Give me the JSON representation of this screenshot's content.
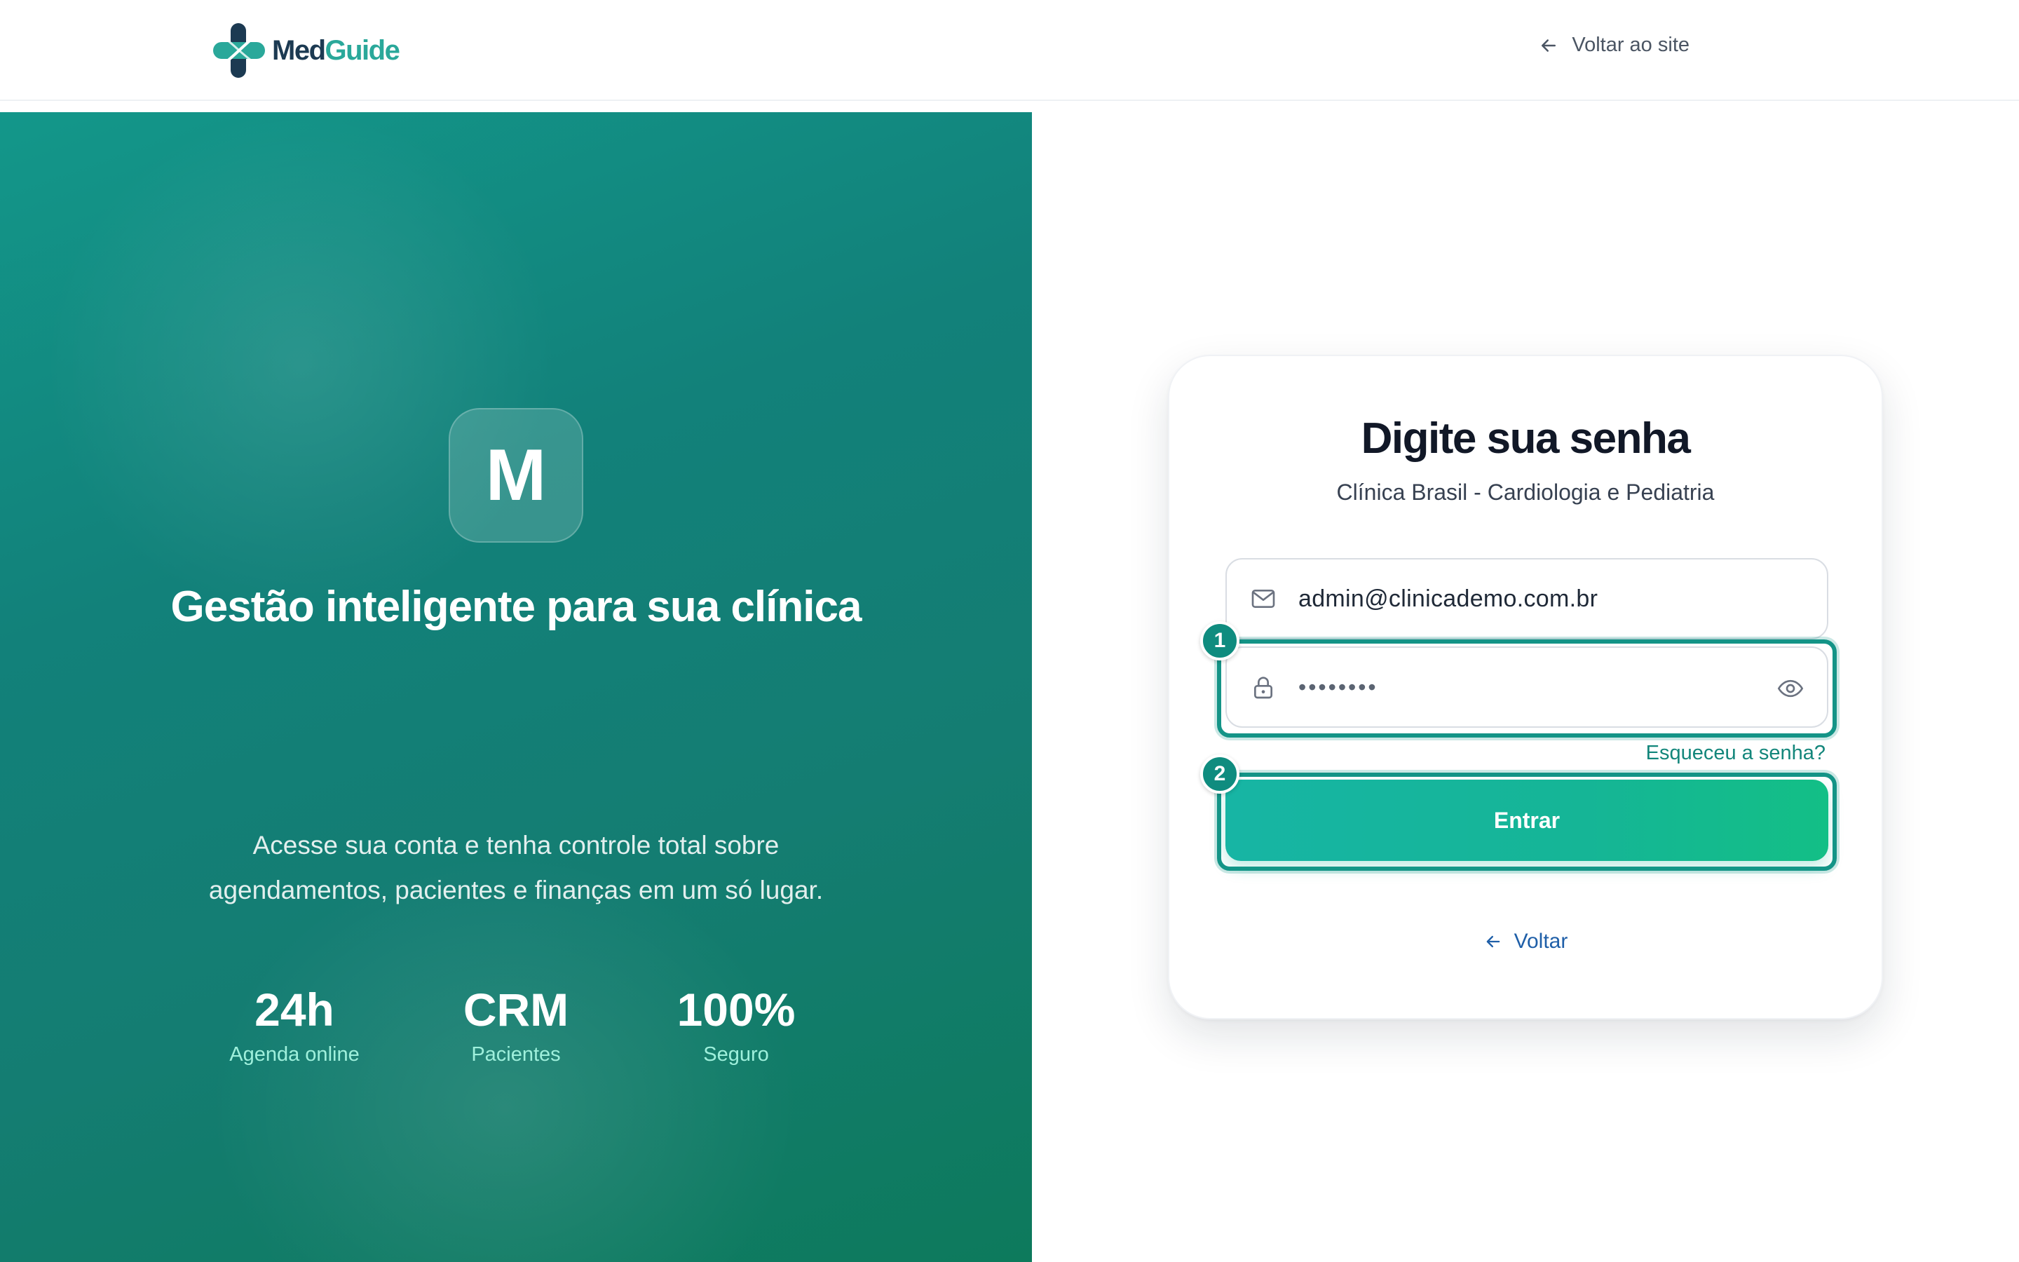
{
  "header": {
    "logo_part1": "Med",
    "logo_part2": "Guide",
    "back_to_site": "Voltar ao site"
  },
  "hero": {
    "badge_letter": "M",
    "title": "Gestão inteligente para sua clínica",
    "description": "Acesse sua conta e tenha controle total sobre agendamentos, pacientes e finanças em um só lugar.",
    "stats": [
      {
        "value": "24h",
        "label": "Agenda online"
      },
      {
        "value": "CRM",
        "label": "Pacientes"
      },
      {
        "value": "100%",
        "label": "Seguro"
      }
    ]
  },
  "login": {
    "title": "Digite sua senha",
    "subtitle": "Clínica Brasil - Cardiologia e Pediatria",
    "email_value": "admin@clinicademo.com.br",
    "password_mask": "••••••••",
    "forgot": "Esqueceu a senha?",
    "submit": "Entrar",
    "back": "Voltar"
  },
  "annotations": {
    "marker1": "1",
    "marker2": "2"
  },
  "colors": {
    "brand_teal": "#149487",
    "button_gradient_start": "#17b5a4",
    "button_gradient_end": "#13bf86",
    "link_blue": "#1f5fa8",
    "panel_green": "#12817a"
  },
  "icons": [
    "logo-icon",
    "arrow-left-icon",
    "mail-icon",
    "lock-icon",
    "eye-icon"
  ]
}
